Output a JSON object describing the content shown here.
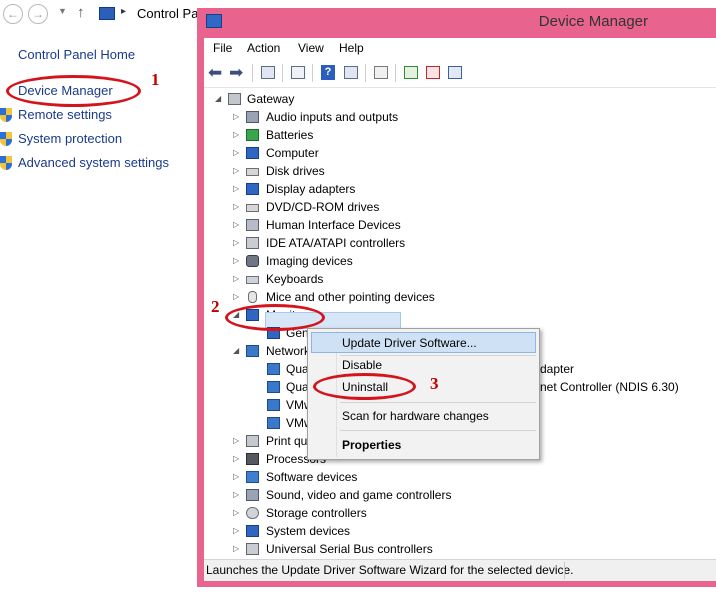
{
  "control_panel": {
    "address": "Control Panel",
    "home_link": "Control Panel Home",
    "links": [
      "Device Manager",
      "Remote settings",
      "System protection",
      "Advanced system settings"
    ]
  },
  "device_manager": {
    "title": "Device Manager",
    "menu": [
      "File",
      "Action",
      "View",
      "Help"
    ],
    "tree": {
      "root": "Gateway",
      "categories": [
        "Audio inputs and outputs",
        "Batteries",
        "Computer",
        "Disk drives",
        "Display adapters",
        "DVD/CD-ROM drives",
        "Human Interface Devices",
        "IDE ATA/ATAPI controllers",
        "Imaging devices",
        "Keyboards",
        "Mice and other pointing devices",
        "Monitors"
      ],
      "monitor_child": "Gen",
      "network_label": "Network",
      "network_children": [
        "Qua",
        "Qua",
        "VMw",
        "VMw"
      ],
      "network_child_tail_1": "dapter",
      "network_child_tail_2": "net Controller (NDIS 6.30)",
      "lower_categories": [
        "Print qu",
        "Processors",
        "Software devices",
        "Sound, video and game controllers",
        "Storage controllers",
        "System devices",
        "Universal Serial Bus controllers"
      ]
    },
    "status_text": "Launches the Update Driver Software Wizard for the selected device."
  },
  "context_menu": {
    "items": [
      "Update Driver Software...",
      "Disable",
      "Uninstall",
      "Scan for hardware changes",
      "Properties"
    ]
  },
  "annotations": {
    "step1": "1",
    "step2": "2",
    "step3": "3",
    "color": "#d4141c"
  },
  "colors": {
    "window_frame": "#e8648f",
    "link": "#1a3a8c",
    "selection": "#d7e6f7"
  }
}
